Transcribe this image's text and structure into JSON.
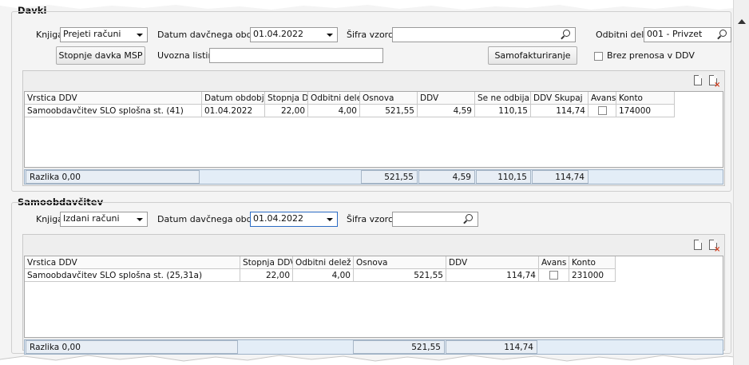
{
  "davki": {
    "title": "Davki",
    "knjiga_label": "Knjiga",
    "knjiga_value": "Prejeti računi",
    "datum_label": "Datum davčnega obdobja",
    "datum_value": "01.04.2022",
    "sifra_label": "Šifra vzorca",
    "sifra_value": "",
    "odbitni_label": "Odbitni delež",
    "odbitni_value": "001 - Privzet",
    "stopnje_btn": "Stopnje davka MSP",
    "uvozna_label": "Uvozna listina",
    "uvozna_value": "",
    "samof_btn": "Samofakturiranje",
    "brez_label": "Brez prenosa v DDV",
    "table": {
      "headers": [
        "Vrstica DDV",
        "Datum obdobja",
        "Stopnja DDV",
        "Odbitni delež",
        "Osnova",
        "DDV",
        "Se ne odbija",
        "DDV Skupaj",
        "Avans",
        "Konto"
      ],
      "rows": [
        [
          "Samoobdavčitev SLO splošna st. (41)",
          "01.04.2022",
          "22,00",
          "4,00",
          "521,55",
          "4,59",
          "110,15",
          "114,74",
          "",
          "174000"
        ]
      ],
      "razlika": "Razlika 0,00",
      "totals": [
        "521,55",
        "4,59",
        "110,15",
        "114,74"
      ]
    }
  },
  "samo": {
    "title": "Samoobdavčitev",
    "knjiga_label": "Knjiga",
    "knjiga_value": "Izdani računi",
    "datum_label": "Datum davčnega obdobja",
    "datum_value": "01.04.2022",
    "sifra_label": "Šifra vzorca",
    "sifra_value": "",
    "table": {
      "headers": [
        "Vrstica DDV",
        "Stopnja DDV",
        "Odbitni delež",
        "Osnova",
        "DDV",
        "Avans",
        "Konto"
      ],
      "rows": [
        [
          "Samoobdavčitev SLO splošna st. (25,31a)",
          "22,00",
          "4,00",
          "521,55",
          "114,74",
          "",
          "231000"
        ]
      ],
      "razlika": "Razlika 0,00",
      "totals": [
        "521,55",
        "114,74"
      ]
    }
  }
}
